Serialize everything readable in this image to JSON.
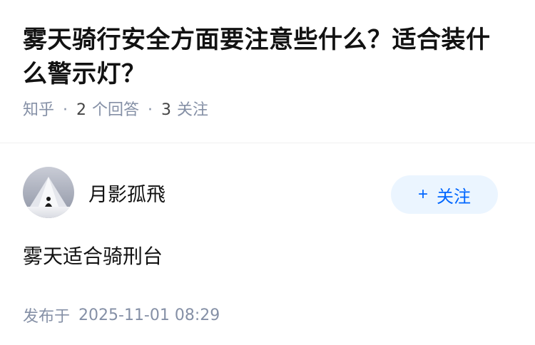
{
  "question": {
    "title": "雾天骑行安全方面要注意些什么？适合装什么警示灯？",
    "source": "知乎",
    "separator": "·",
    "answer_count": "2",
    "answer_label": "个回答",
    "follow_count": "3",
    "follow_label": "关注"
  },
  "answer": {
    "author_name": "月影孤飛",
    "follow_button": {
      "plus": "+",
      "label": "关注"
    },
    "content": "雾天适合骑刑台",
    "publish_label": "发布于",
    "publish_time": "2025-11-01 08:29"
  },
  "colors": {
    "title": "#121212",
    "meta": "#8590a6",
    "accent": "#0066ff",
    "button_bg": "#ebf5ff"
  },
  "icons": {
    "avatar": "avatar-image"
  }
}
